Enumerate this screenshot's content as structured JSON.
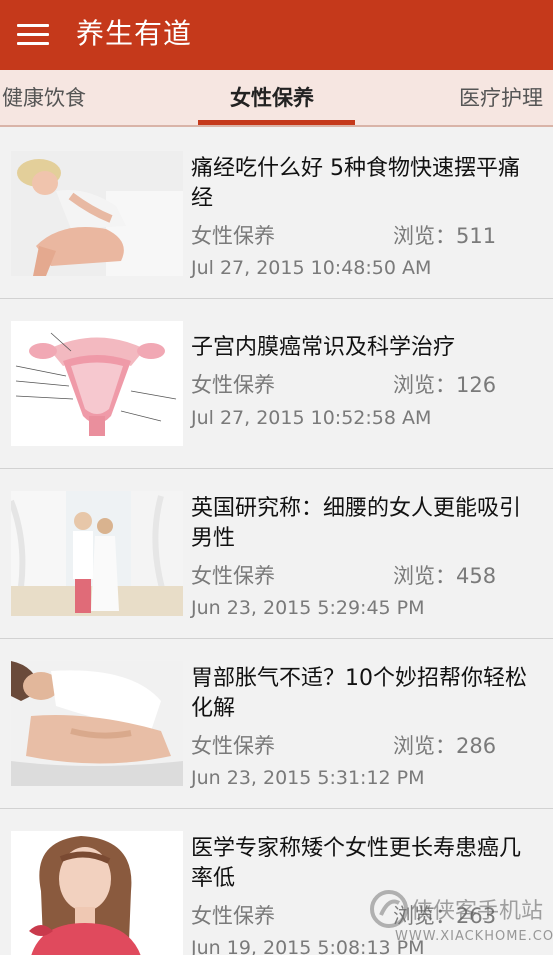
{
  "app": {
    "title": "养生有道",
    "menu_icon": "hamburger-menu-icon",
    "accent": "#c5391b"
  },
  "tabs": [
    {
      "label": "健康饮食",
      "active": false
    },
    {
      "label": "女性保养",
      "active": true
    },
    {
      "label": "医疗护理",
      "active": false
    }
  ],
  "articles": [
    {
      "title": "痛经吃什么好 5种食物快速摆平痛经",
      "category": "女性保养",
      "views": "浏览：511",
      "date": "Jul 27, 2015 10:48:50 AM"
    },
    {
      "title": "子宫内膜癌常识及科学治疗",
      "category": "女性保养",
      "views": "浏览：126",
      "date": "Jul 27, 2015 10:52:58 AM"
    },
    {
      "title": "英国研究称：细腰的女人更能吸引男性",
      "category": "女性保养",
      "views": "浏览：458",
      "date": "Jun 23, 2015 5:29:45 PM"
    },
    {
      "title": "胃部胀气不适？10个妙招帮你轻松化解",
      "category": "女性保养",
      "views": "浏览：286",
      "date": "Jun 23, 2015 5:31:12 PM"
    },
    {
      "title": "医学专家称矮个女性更长寿患癌几率低",
      "category": "女性保养",
      "views": "浏览：263",
      "date": "Jun 19, 2015 5:08:13 PM"
    }
  ],
  "watermark": {
    "cn": "侠侠客手机站",
    "en": "WWW.XIACKHOME.COM"
  }
}
